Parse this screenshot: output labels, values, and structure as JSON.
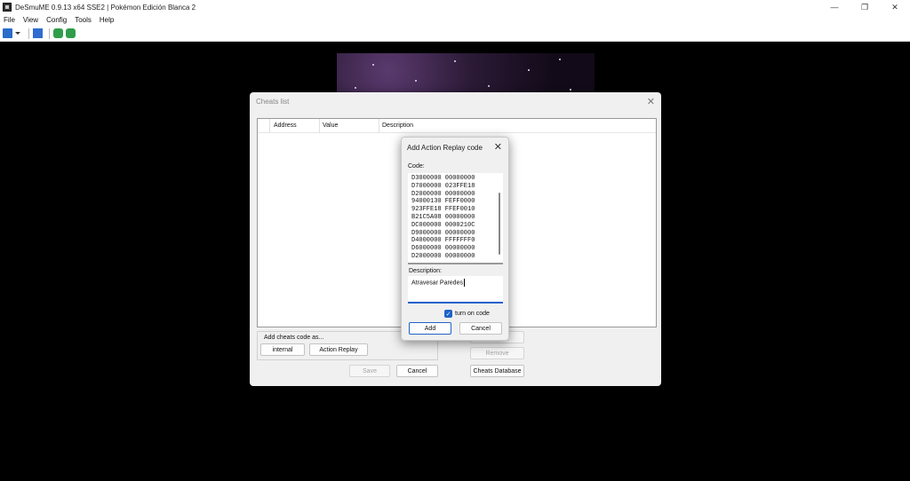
{
  "window": {
    "title": "DeSmuME 0.9.13 x64 SSE2 | Pokémon Edición Blanca 2",
    "controls": {
      "minimize": "—",
      "restore": "❐",
      "close": "✕"
    }
  },
  "menu": {
    "items": [
      "File",
      "View",
      "Config",
      "Tools",
      "Help"
    ]
  },
  "toolbar": {
    "icons": [
      "open-rom-icon",
      "dropdown-arrow-icon",
      "pause-icon",
      "wifi-icon",
      "wifi-settings-icon"
    ]
  },
  "cheats_list": {
    "title": "Cheats list",
    "close_glyph": "✕",
    "columns": [
      "Address",
      "Value",
      "Description"
    ],
    "rows": [],
    "add_group_label": "Add cheats code as...",
    "internal_label": "internal",
    "action_replay_label": "Action Replay",
    "remove_label": "Remove",
    "save_label": "Save",
    "cancel_label": "Cancel",
    "database_label": "Cheats Database"
  },
  "add_ar": {
    "title": "Add Action Replay code",
    "close_glyph": "✕",
    "code_label": "Code:",
    "code_lines": [
      "D3000000 00000000",
      "D7000000 023FFE18",
      "D2000000 00000000",
      "94000130 FEFF0000",
      "923FFE18 FFEF0010",
      "B21C5A08 00000000",
      "DC000000 0000210C",
      "D9000000 00000000",
      "D4000000 FFFFFFF0",
      "D6000000 00000000",
      "D2000000 00000000"
    ],
    "description_label": "Description:",
    "description_value": "Atravesar Paredes",
    "turn_on_label": "turn on code",
    "turn_on_checked": true,
    "add_label": "Add",
    "cancel_label": "Cancel"
  },
  "colors": {
    "accent": "#1f62c8",
    "emulator_bg": "#000000",
    "dialog_bg": "#f0f0f0"
  }
}
